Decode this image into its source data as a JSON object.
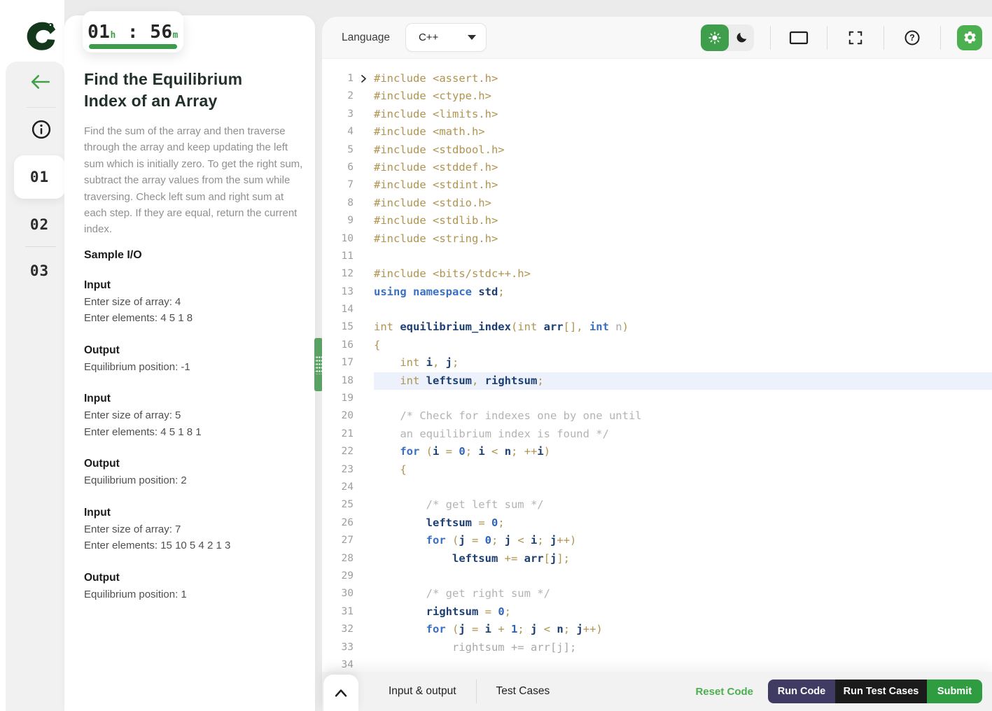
{
  "colors": {
    "accent_green": "#43a047",
    "logo_green": "#14381c",
    "run_code_bg": "#3f3b63",
    "run_tests_bg": "#1b1b1b",
    "submit_bg": "#2f9c41",
    "reset_link": "#4caf50",
    "line_highlight": "#edf1fb"
  },
  "sidebar": {
    "questions": [
      {
        "label": "01",
        "active": true
      },
      {
        "label": "02",
        "active": false
      },
      {
        "label": "03",
        "active": false
      }
    ]
  },
  "timer": {
    "hours": "01",
    "hours_unit": "h",
    "separator": " : ",
    "minutes": "56",
    "minutes_unit": "m"
  },
  "problem": {
    "title": "Find the Equilibrium Index of an Array",
    "description": "Find the sum of the array and then traverse through the array and keep updating the left sum which is initially zero. To get the right sum, subtract the array values from the sum while traversing. Check left sum and right sum at each step. If they are equal, return the current index.",
    "sample_heading": "Sample I/O",
    "samples": [
      {
        "input_label": "Input",
        "input_lines": [
          "Enter size of array: 4",
          "Enter elements: 4 5 1 8"
        ],
        "output_label": "Output",
        "output_lines": [
          "Equilibrium position: -1"
        ]
      },
      {
        "input_label": "Input",
        "input_lines": [
          "Enter size of array: 5",
          "Enter elements: 4 5 1 8 1"
        ],
        "output_label": "Output",
        "output_lines": [
          "Equilibrium position: 2"
        ]
      },
      {
        "input_label": "Input",
        "input_lines": [
          "Enter size of array: 7",
          "Enter elements: 15 10 5 4 2 1 3"
        ],
        "output_label": "Output",
        "output_lines": [
          "Equilibrium position: 1"
        ]
      }
    ]
  },
  "editor": {
    "language_label": "Language",
    "language_value": "C++",
    "lines": [
      {
        "n": 1,
        "fold": true,
        "tk": [
          [
            "t",
            "#include <assert.h>"
          ]
        ]
      },
      {
        "n": 2,
        "tk": [
          [
            "t",
            "#include <ctype.h>"
          ]
        ]
      },
      {
        "n": 3,
        "tk": [
          [
            "t",
            "#include <limits.h>"
          ]
        ]
      },
      {
        "n": 4,
        "tk": [
          [
            "t",
            "#include <math.h>"
          ]
        ]
      },
      {
        "n": 5,
        "tk": [
          [
            "t",
            "#include <stdbool.h>"
          ]
        ]
      },
      {
        "n": 6,
        "tk": [
          [
            "t",
            "#include <stddef.h>"
          ]
        ]
      },
      {
        "n": 7,
        "tk": [
          [
            "t",
            "#include <stdint.h>"
          ]
        ]
      },
      {
        "n": 8,
        "tk": [
          [
            "t",
            "#include <stdio.h>"
          ]
        ]
      },
      {
        "n": 9,
        "tk": [
          [
            "t",
            "#include <stdlib.h>"
          ]
        ]
      },
      {
        "n": 10,
        "tk": [
          [
            "t",
            "#include <string.h>"
          ]
        ]
      },
      {
        "n": 11,
        "tk": []
      },
      {
        "n": 12,
        "tk": [
          [
            "t",
            "#include <bits/stdc++.h>"
          ]
        ]
      },
      {
        "n": 13,
        "tk": [
          [
            "k",
            "using namespace "
          ],
          [
            "v",
            "std"
          ],
          [
            "t",
            ";"
          ]
        ]
      },
      {
        "n": 14,
        "tk": []
      },
      {
        "n": 15,
        "tk": [
          [
            "t",
            "int "
          ],
          [
            "v",
            "equilibrium_index"
          ],
          [
            "t",
            "(int "
          ],
          [
            "v",
            "arr"
          ],
          [
            "t",
            "[], "
          ],
          [
            "k",
            "int "
          ],
          [
            "d",
            "n"
          ],
          [
            "t",
            ")"
          ]
        ]
      },
      {
        "n": 16,
        "tk": [
          [
            "t",
            "{"
          ]
        ]
      },
      {
        "n": 17,
        "tk": [
          [
            "t",
            "    int "
          ],
          [
            "v",
            "i"
          ],
          [
            "t",
            ", "
          ],
          [
            "v",
            "j"
          ],
          [
            "t",
            ";"
          ]
        ]
      },
      {
        "n": 18,
        "hl": true,
        "tk": [
          [
            "t",
            "    int "
          ],
          [
            "v",
            "leftsum"
          ],
          [
            "t",
            ", "
          ],
          [
            "v",
            "rightsum"
          ],
          [
            "t",
            ";"
          ]
        ]
      },
      {
        "n": 19,
        "tk": []
      },
      {
        "n": 20,
        "tk": [
          [
            "c",
            "    /* Check for indexes one by one until"
          ]
        ]
      },
      {
        "n": 21,
        "tk": [
          [
            "c",
            "    an equilibrium index is found */"
          ]
        ]
      },
      {
        "n": 22,
        "tk": [
          [
            "t",
            "    "
          ],
          [
            "k",
            "for "
          ],
          [
            "t",
            "("
          ],
          [
            "v",
            "i"
          ],
          [
            "t",
            " = "
          ],
          [
            "n",
            "0"
          ],
          [
            "t",
            "; "
          ],
          [
            "v",
            "i"
          ],
          [
            "t",
            " < "
          ],
          [
            "v",
            "n"
          ],
          [
            "t",
            "; ++"
          ],
          [
            "v",
            "i"
          ],
          [
            "t",
            ")"
          ]
        ]
      },
      {
        "n": 23,
        "tk": [
          [
            "t",
            "    {"
          ]
        ]
      },
      {
        "n": 24,
        "tk": []
      },
      {
        "n": 25,
        "tk": [
          [
            "c",
            "        /* get left sum */"
          ]
        ]
      },
      {
        "n": 26,
        "tk": [
          [
            "t",
            "        "
          ],
          [
            "v",
            "leftsum"
          ],
          [
            "t",
            " = "
          ],
          [
            "n",
            "0"
          ],
          [
            "t",
            ";"
          ]
        ]
      },
      {
        "n": 27,
        "tk": [
          [
            "t",
            "        "
          ],
          [
            "k",
            "for "
          ],
          [
            "t",
            "("
          ],
          [
            "v",
            "j"
          ],
          [
            "t",
            " = "
          ],
          [
            "n",
            "0"
          ],
          [
            "t",
            "; "
          ],
          [
            "v",
            "j"
          ],
          [
            "t",
            " < "
          ],
          [
            "v",
            "i"
          ],
          [
            "t",
            "; "
          ],
          [
            "v",
            "j"
          ],
          [
            "t",
            "++)"
          ]
        ]
      },
      {
        "n": 28,
        "tk": [
          [
            "t",
            "            "
          ],
          [
            "v",
            "leftsum"
          ],
          [
            "t",
            " += "
          ],
          [
            "v",
            "arr"
          ],
          [
            "t",
            "["
          ],
          [
            "v",
            "j"
          ],
          [
            "t",
            "];"
          ]
        ]
      },
      {
        "n": 29,
        "tk": []
      },
      {
        "n": 30,
        "tk": [
          [
            "c",
            "        /* get right sum */"
          ]
        ]
      },
      {
        "n": 31,
        "tk": [
          [
            "t",
            "        "
          ],
          [
            "v",
            "rightsum"
          ],
          [
            "t",
            " = "
          ],
          [
            "n",
            "0"
          ],
          [
            "t",
            ";"
          ]
        ]
      },
      {
        "n": 32,
        "tk": [
          [
            "t",
            "        "
          ],
          [
            "k",
            "for "
          ],
          [
            "t",
            "("
          ],
          [
            "v",
            "j"
          ],
          [
            "t",
            " = "
          ],
          [
            "v",
            "i"
          ],
          [
            "t",
            " + "
          ],
          [
            "n",
            "1"
          ],
          [
            "t",
            "; "
          ],
          [
            "v",
            "j"
          ],
          [
            "t",
            " < "
          ],
          [
            "v",
            "n"
          ],
          [
            "t",
            "; "
          ],
          [
            "v",
            "j"
          ],
          [
            "t",
            "++)"
          ]
        ]
      },
      {
        "n": 33,
        "tk": [
          [
            "d",
            "            rightsum += arr[j];"
          ]
        ]
      },
      {
        "n": 34,
        "tk": []
      }
    ]
  },
  "bottombar": {
    "tab_io": "Input & output",
    "tab_tests": "Test Cases",
    "reset_label": "Reset Code",
    "run_code_label": "Run Code",
    "run_tests_label": "Run Test Cases",
    "submit_label": "Submit"
  }
}
